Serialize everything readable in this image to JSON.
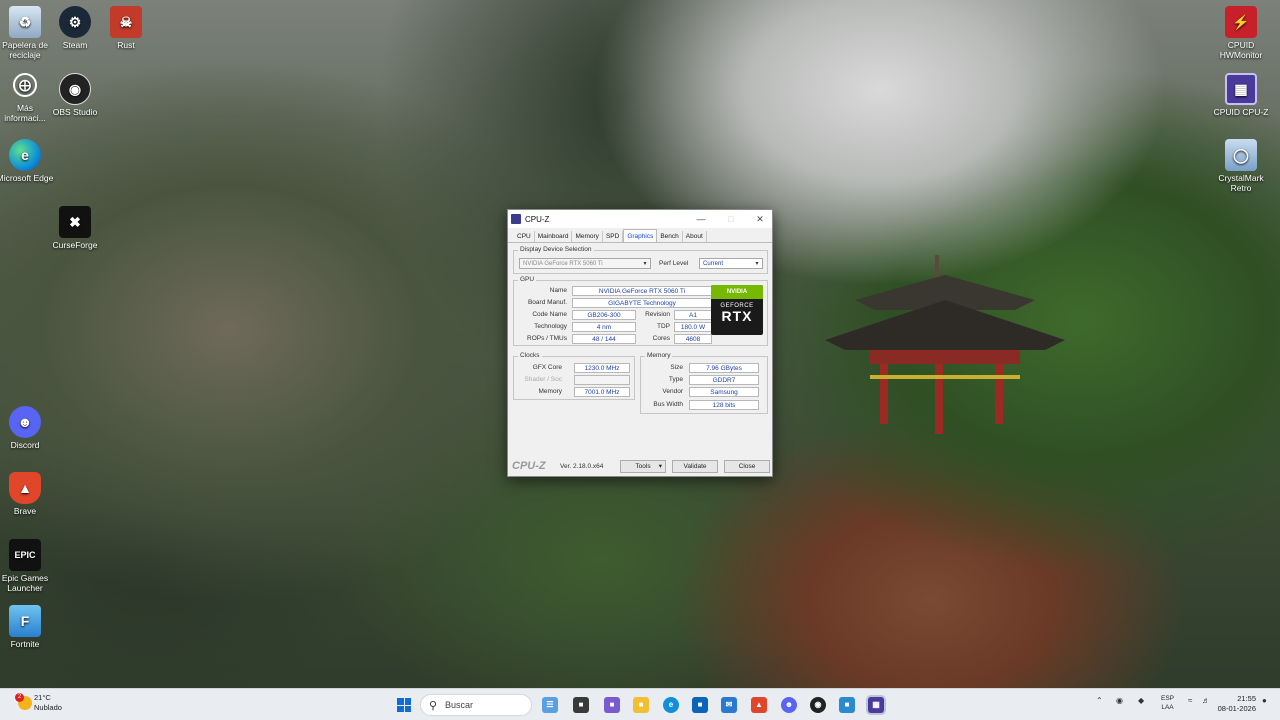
{
  "desktop": {
    "icons": [
      {
        "label": "Papelera de reciclaje",
        "icon": "recycle-bin-icon",
        "color": "#9fb8d0"
      },
      {
        "label": "Steam",
        "icon": "steam-icon",
        "color": "#1b2838"
      },
      {
        "label": "Rust",
        "icon": "rust-icon",
        "color": "#c23a2a"
      },
      {
        "label": "Más informaci...",
        "icon": "info-icon",
        "color": "#444"
      },
      {
        "label": "OBS Studio",
        "icon": "obs-icon",
        "color": "#222"
      },
      {
        "label": "Microsoft Edge",
        "icon": "edge-icon",
        "color": "#0f8fd9"
      },
      {
        "label": "CurseForge",
        "icon": "curseforge-icon",
        "color": "#111"
      },
      {
        "label": "Discord",
        "icon": "discord-icon",
        "color": "#5865f2"
      },
      {
        "label": "Brave",
        "icon": "brave-icon",
        "color": "#e0462a"
      },
      {
        "label": "Epic Games Launcher",
        "icon": "epic-games-icon",
        "color": "#111"
      },
      {
        "label": "Fortnite",
        "icon": "fortnite-icon",
        "color": "#3aa0e6"
      },
      {
        "label": "CPUID HWMonitor",
        "icon": "hwmonitor-icon",
        "color": "#c8202a"
      },
      {
        "label": "CPUID CPU-Z",
        "icon": "cpuz-icon",
        "color": "#4a3a9c"
      },
      {
        "label": "CrystalMark Retro",
        "icon": "crystalmark-icon",
        "color": "#7aa0c8"
      }
    ]
  },
  "cpuz": {
    "title": "CPU-Z",
    "tabs": [
      "CPU",
      "Mainboard",
      "Memory",
      "SPD",
      "Graphics",
      "Bench",
      "About"
    ],
    "active_tab": "Graphics",
    "display_selection": {
      "legend": "Display Device Selection",
      "device": "NVIDIA GeForce RTX 5060 Ti",
      "perf_label": "Perf Level",
      "perf_value": "Current"
    },
    "gpu": {
      "legend": "GPU",
      "name_label": "Name",
      "name": "NVIDIA GeForce RTX 5060 Ti",
      "board_label": "Board Manuf.",
      "board": "GIGABYTE Technology",
      "code_label": "Code Name",
      "code": "GB206-300",
      "revision_label": "Revision",
      "revision": "A1",
      "tech_label": "Technology",
      "tech": "4 nm",
      "tdp_label": "TDP",
      "tdp": "180.0 W",
      "rops_label": "ROPs / TMUs",
      "rops": "48 / 144",
      "cores_label": "Cores",
      "cores": "4608"
    },
    "badge": {
      "brand": "NVIDIA",
      "line1": "GEFORCE",
      "line2": "RTX"
    },
    "clocks": {
      "legend": "Clocks",
      "gfx_label": "GFX Core",
      "gfx": "1230.0 MHz",
      "shader_label": "Shader / Soc",
      "memory_label": "Memory",
      "memory": "7001.0 MHz"
    },
    "memory": {
      "legend": "Memory",
      "size_label": "Size",
      "size": "7.96 GBytes",
      "type_label": "Type",
      "type": "GDDR7",
      "vendor_label": "Vendor",
      "vendor": "Samsung",
      "bus_label": "Bus Width",
      "bus": "128 bits"
    },
    "footer": {
      "brand": "CPU-Z",
      "version": "Ver. 2.18.0.x64",
      "tools": "Tools",
      "validate": "Validate",
      "close": "Close"
    }
  },
  "taskbar": {
    "weather_temp": "21°C",
    "weather_desc": "Nublado",
    "weather_badge": "2",
    "search_placeholder": "Buscar",
    "lang_line1": "ESP",
    "lang_line2": "LAA",
    "time": "21:55",
    "date": "08-01-2026"
  }
}
